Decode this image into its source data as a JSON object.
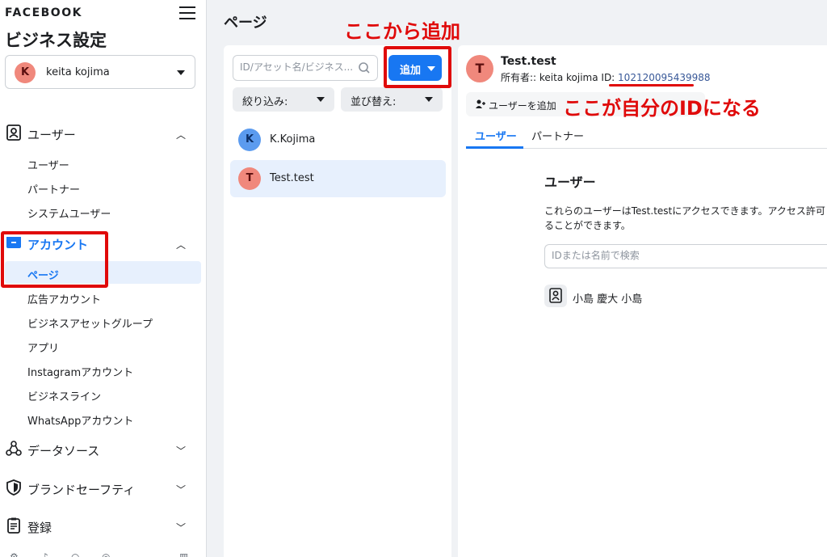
{
  "sidebar": {
    "brand": "FACEBOOK",
    "title": "ビジネス設定",
    "account": {
      "avatar_letter": "K",
      "name": "keita kojima"
    },
    "sections": {
      "users": {
        "label": "ユーザー",
        "items": [
          "ユーザー",
          "パートナー",
          "システムユーザー"
        ]
      },
      "accounts": {
        "label": "アカウント",
        "items": [
          "ページ",
          "広告アカウント",
          "ビジネスアセットグループ",
          "アプリ",
          "Instagramアカウント",
          "ビジネスライン",
          "WhatsAppアカウント"
        ]
      },
      "data_sources": {
        "label": "データソース"
      },
      "brand_safety": {
        "label": "ブランドセーフティ"
      },
      "registration": {
        "label": "登録"
      }
    }
  },
  "main": {
    "heading": "ページ"
  },
  "list": {
    "search_placeholder": "ID/アセット名/ビジネス...",
    "add_label": "追加",
    "filter_label": "絞り込み:",
    "sort_label": "並び替え:",
    "items": [
      {
        "letter": "K",
        "name": "K.Kojima",
        "color": "#5b9bef"
      },
      {
        "letter": "T",
        "name": "Test.test",
        "color": "#f0887c"
      }
    ]
  },
  "detail": {
    "avatar_letter": "T",
    "title": "Test.test",
    "owner_prefix": "所有者:: keita kojima  ID: ",
    "id_value": "102120095439988",
    "add_user_label": "ユーザーを追加",
    "tabs": [
      "ユーザー",
      "パートナー"
    ],
    "users_heading": "ユーザー",
    "users_desc_line1": "これらのユーザーはTest.testにアクセスできます。アクセス許可",
    "users_desc_line2": "ることができます。",
    "user_search_placeholder": "IDまたは名前で検索",
    "user_name": "小島 慶大 小島"
  },
  "annotations": {
    "add_here": "ここから追加",
    "id_note": "ここが自分のIDになる"
  },
  "colors": {
    "accent": "#1877f2",
    "annotation_red": "#e00a0a",
    "selected_bg": "#e7f0fd"
  }
}
